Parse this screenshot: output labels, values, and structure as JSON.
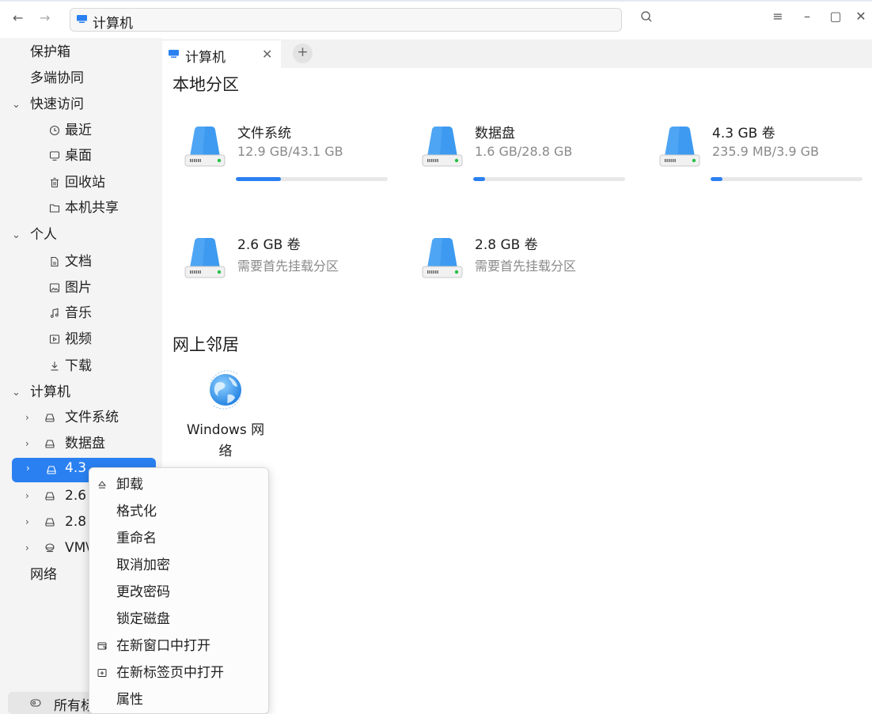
{
  "titlebar": {
    "back_icon": "arrow-left-icon",
    "forward_icon": "arrow-right-icon",
    "address_text": "计算机",
    "search_icon": "search-icon",
    "menu_icon": "hamburger-menu-icon",
    "minimize_icon": "minimize-icon",
    "maximize_icon": "maximize-icon",
    "close_icon": "close-icon"
  },
  "sidebar": {
    "items": [
      {
        "label": "保护箱"
      },
      {
        "label": "多端协同"
      },
      {
        "label": "快速访问"
      },
      {
        "label": "最近",
        "icon": "clock-icon"
      },
      {
        "label": "桌面",
        "icon": "monitor-icon"
      },
      {
        "label": "回收站",
        "icon": "trash-icon"
      },
      {
        "label": "本机共享",
        "icon": "folder-icon"
      },
      {
        "label": "个人"
      },
      {
        "label": "文档",
        "icon": "document-icon"
      },
      {
        "label": "图片",
        "icon": "image-icon"
      },
      {
        "label": "音乐",
        "icon": "music-icon"
      },
      {
        "label": "视频",
        "icon": "video-icon"
      },
      {
        "label": "下载",
        "icon": "download-icon"
      },
      {
        "label": "计算机"
      },
      {
        "label": "文件系统",
        "icon": "drive-icon"
      },
      {
        "label": "数据盘",
        "icon": "drive-icon"
      },
      {
        "label": "4.3",
        "icon": "drive-icon"
      },
      {
        "label": "2.6",
        "icon": "drive-icon"
      },
      {
        "label": "2.8",
        "icon": "drive-icon"
      },
      {
        "label": "VM\\",
        "icon": "eject-drive-icon"
      },
      {
        "label": "网络"
      }
    ],
    "bottom_label": "所有标"
  },
  "tabs": {
    "active_label": "计算机",
    "close_icon": "close-icon",
    "add_icon": "plus-icon"
  },
  "local": {
    "title": "本地分区",
    "disks": [
      {
        "name": "文件系统",
        "usage": "12.9 GB/43.1 GB",
        "used_fraction": 0.299
      },
      {
        "name": "数据盘",
        "usage": "1.6 GB/28.8 GB",
        "used_fraction": 0.056
      },
      {
        "name": "4.3 GB 卷",
        "usage": "235.9 MB/3.9 GB",
        "used_fraction": 0.059
      },
      {
        "name": "2.6 GB 卷",
        "usage": "需要首先挂载分区"
      },
      {
        "name": "2.8 GB 卷",
        "usage": "需要首先挂载分区"
      }
    ]
  },
  "network": {
    "title": "网上邻居",
    "items": [
      {
        "label_line1": "Windows 网",
        "label_line2": "络"
      }
    ]
  },
  "context_menu": {
    "items": [
      {
        "label": "卸载",
        "icon": "eject-icon"
      },
      {
        "label": "格式化"
      },
      {
        "label": "重命名"
      },
      {
        "label": "取消加密"
      },
      {
        "label": "更改密码"
      },
      {
        "label": "锁定磁盘"
      },
      {
        "label": "在新窗口中打开",
        "icon": "new-window-icon"
      },
      {
        "label": "在新标签页中打开",
        "icon": "new-tab-icon"
      },
      {
        "label": "属性"
      }
    ]
  },
  "colors": {
    "accent": "#2a80f0",
    "sidebar_bg": "#f4f4f4",
    "muted_text": "#8a8a8a"
  }
}
